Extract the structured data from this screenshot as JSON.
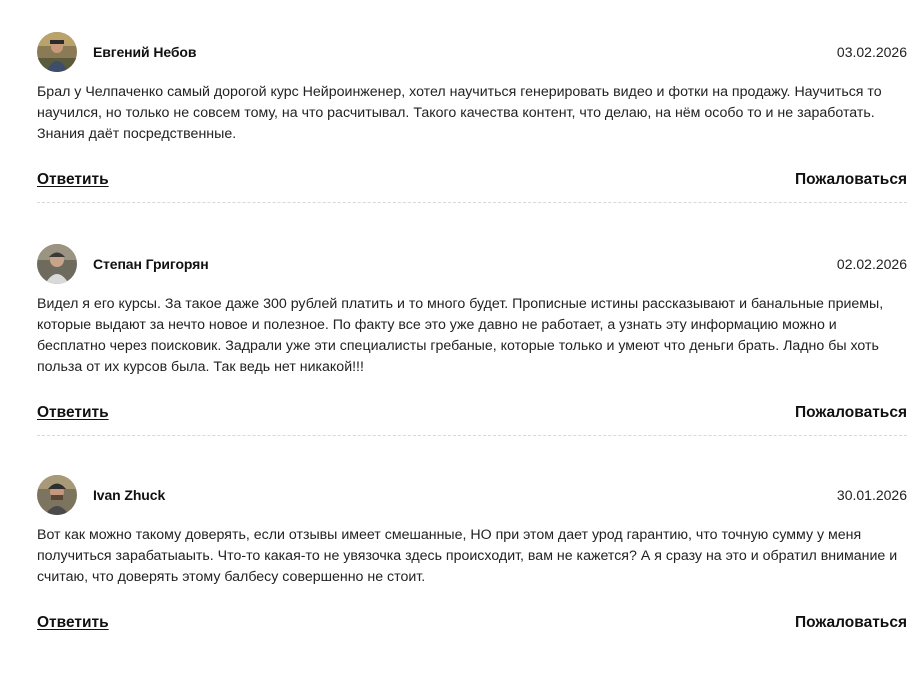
{
  "comments": [
    {
      "author": "Евгений Небов",
      "date": "03.02.2026",
      "text": "Брал у Челпаченко самый дорогой курс Нейроинженер, хотел научиться генерировать видео и фотки на продажу. Научиться то научился, но только не совсем тому, на что расчитывал. Такого качества контент, что делаю, на нём особо то и не заработать. Знания даёт посредственные.",
      "reply_label": "Ответить",
      "report_label": "Пожаловаться",
      "avatar_icon": "avatar-photo-man-outdoors"
    },
    {
      "author": "Степан Григорян",
      "date": "02.02.2026",
      "text": "Видел я его курсы. За такое даже 300 рублей платить и то много будет. Прописные истины рассказывают и банальные приемы, которые выдают за нечто новое и полезное. По факту все это уже давно не работает, а узнать эту информацию можно и бесплатно через поисковик. Задрали уже эти специалисты гребаные, которые только и умеют что деньги брать. Ладно бы хоть польза от их курсов была. Так ведь нет никакой!!!",
      "reply_label": "Ответить",
      "report_label": "Пожаловаться",
      "avatar_icon": "avatar-photo-man-cap"
    },
    {
      "author": "Ivan Zhuck",
      "date": "30.01.2026",
      "text": "Вот как можно такому доверять, если отзывы имеет смешанные, НО при этом дает урод гарантию, что точную сумму у меня получиться зарабатыаыть. Что-то какая-то не увязочка здесь происходит, вам не кажется? А я сразу на это и обратил внимание и считаю, что доверять этому балбесу совершенно не стоит.",
      "reply_label": "Ответить",
      "report_label": "Пожаловаться",
      "avatar_icon": "avatar-photo-man-cap-beard"
    }
  ],
  "colors": {
    "text": "#222222",
    "divider": "#d8d8d8",
    "background": "#ffffff"
  }
}
